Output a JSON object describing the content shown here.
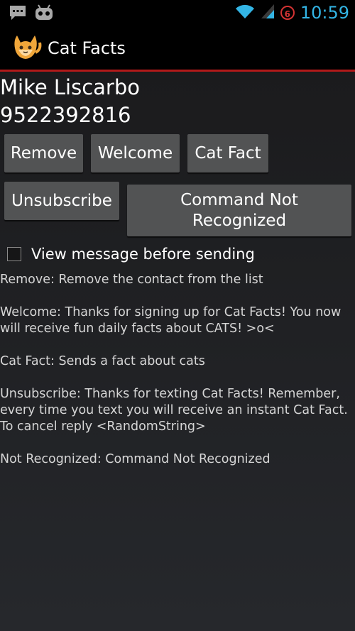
{
  "status_bar": {
    "time": "10:59",
    "badge_count": "6",
    "icons": [
      "chat-notification-icon",
      "android-robot-icon",
      "wifi-icon",
      "signal-icon"
    ]
  },
  "action_bar": {
    "title": "Cat Facts",
    "app_icon": "cat-icon"
  },
  "contact": {
    "name": "Mike Liscarbo",
    "phone": "9522392816"
  },
  "buttons": {
    "remove": "Remove",
    "welcome": "Welcome",
    "cat_fact": "Cat Fact",
    "unsubscribe": "Unsubscribe",
    "not_recognized": "Command Not Recognized"
  },
  "checkbox": {
    "label": "View message before sending",
    "checked": false
  },
  "descriptions": [
    "Remove: Remove the contact from the list",
    "Welcome: Thanks for signing up for Cat Facts! You now will receive fun daily facts about CATS! >o<",
    "Cat Fact: Sends a fact about cats",
    "Unsubscribe: Thanks for texting Cat Facts! Remember, every time you text you will receive an instant Cat Fact. To cancel reply <RandomString>",
    "Not Recognized: Command Not Recognized"
  ],
  "colors": {
    "accent": "#33b5e5",
    "divider": "#b21a1a",
    "button": "#525354"
  }
}
